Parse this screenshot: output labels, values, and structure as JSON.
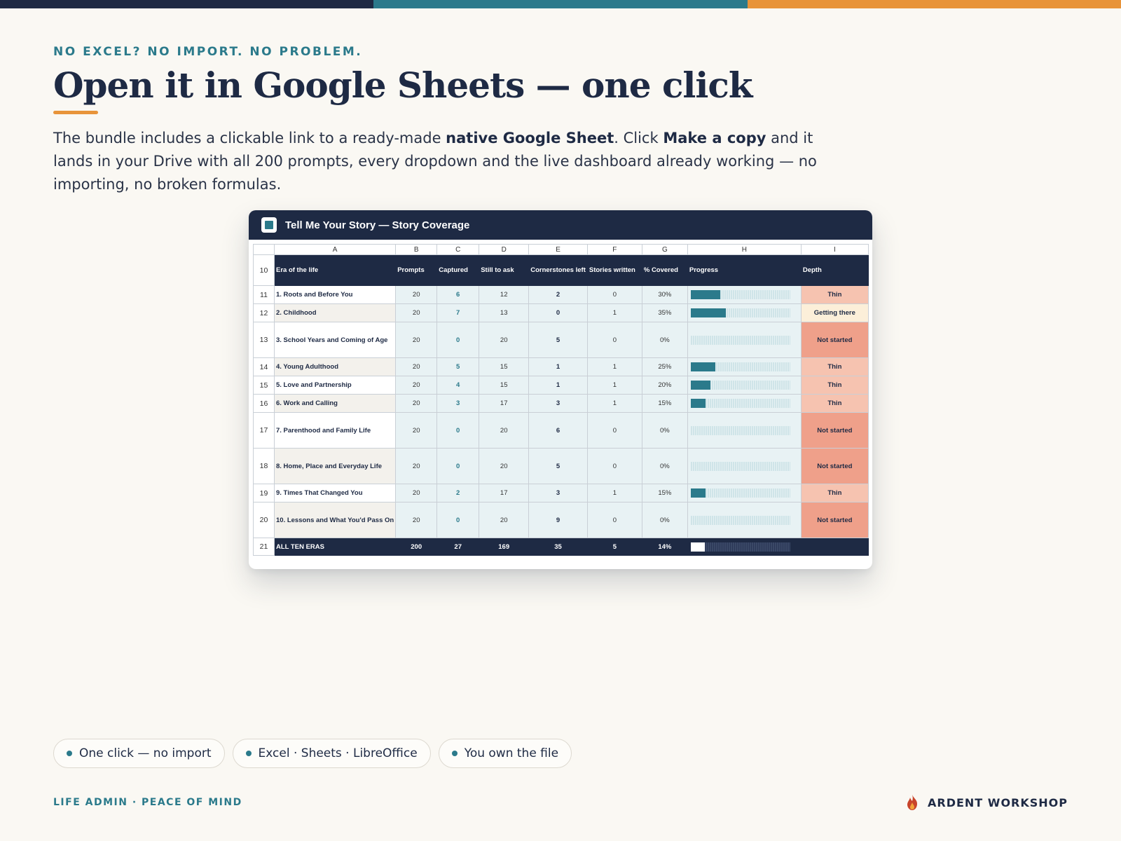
{
  "colors": {
    "navy": "#1E2A44",
    "teal": "#2B7A8B",
    "orange": "#E8943A",
    "background": "#FAF8F3",
    "depth_thin": "#F6C3B0",
    "depth_getting_there": "#FCEFD9",
    "depth_not_started": "#EFA08A"
  },
  "kicker": "NO EXCEL? NO IMPORT. NO PROBLEM.",
  "title": "Open it in Google Sheets — one click",
  "lede": {
    "part1": "The bundle includes a clickable link to a ready-made ",
    "bold1": "native Google Sheet",
    "part2": ". Click ",
    "bold2": "Make a copy",
    "part3": " and it lands in your Drive with all 200 prompts, every dropdown and the live dashboard already working — no importing, no broken formulas."
  },
  "sheet": {
    "icon": "sheets-icon",
    "title": "Tell Me Your Story — Story Coverage",
    "column_letters": [
      "A",
      "B",
      "C",
      "D",
      "E",
      "F",
      "G",
      "H",
      "I"
    ],
    "header_row_num": "10",
    "headers": [
      "Era of the life",
      "Prompts",
      "Captured",
      "Still to ask",
      "Cornerstones left",
      "Stories written",
      "% Covered",
      "Progress",
      "Depth"
    ],
    "rows": [
      {
        "num": "11",
        "era": "1. Roots and Before You",
        "prompts": "20",
        "captured": "6",
        "still": "12",
        "corner": "2",
        "stories": "0",
        "pct": "30%",
        "progress": 0.3,
        "depth": "Thin"
      },
      {
        "num": "12",
        "era": "2. Childhood",
        "prompts": "20",
        "captured": "7",
        "still": "13",
        "corner": "0",
        "stories": "1",
        "pct": "35%",
        "progress": 0.35,
        "depth": "Getting there"
      },
      {
        "num": "13",
        "era": "3. School Years and Coming of Age",
        "prompts": "20",
        "captured": "0",
        "still": "20",
        "corner": "5",
        "stories": "0",
        "pct": "0%",
        "progress": 0,
        "depth": "Not started"
      },
      {
        "num": "14",
        "era": "4. Young Adulthood",
        "prompts": "20",
        "captured": "5",
        "still": "15",
        "corner": "1",
        "stories": "1",
        "pct": "25%",
        "progress": 0.25,
        "depth": "Thin"
      },
      {
        "num": "15",
        "era": "5. Love and Partnership",
        "prompts": "20",
        "captured": "4",
        "still": "15",
        "corner": "1",
        "stories": "1",
        "pct": "20%",
        "progress": 0.2,
        "depth": "Thin"
      },
      {
        "num": "16",
        "era": "6. Work and Calling",
        "prompts": "20",
        "captured": "3",
        "still": "17",
        "corner": "3",
        "stories": "1",
        "pct": "15%",
        "progress": 0.15,
        "depth": "Thin"
      },
      {
        "num": "17",
        "era": "7. Parenthood and Family Life",
        "prompts": "20",
        "captured": "0",
        "still": "20",
        "corner": "6",
        "stories": "0",
        "pct": "0%",
        "progress": 0,
        "depth": "Not started"
      },
      {
        "num": "18",
        "era": "8. Home, Place and Everyday Life",
        "prompts": "20",
        "captured": "0",
        "still": "20",
        "corner": "5",
        "stories": "0",
        "pct": "0%",
        "progress": 0,
        "depth": "Not started"
      },
      {
        "num": "19",
        "era": "9. Times That Changed You",
        "prompts": "20",
        "captured": "2",
        "still": "17",
        "corner": "3",
        "stories": "1",
        "pct": "15%",
        "progress": 0.15,
        "depth": "Thin"
      },
      {
        "num": "20",
        "era": "10. Lessons and What You'd Pass On",
        "prompts": "20",
        "captured": "0",
        "still": "20",
        "corner": "9",
        "stories": "0",
        "pct": "0%",
        "progress": 0,
        "depth": "Not started"
      }
    ],
    "total": {
      "num": "21",
      "era": "ALL TEN ERAS",
      "prompts": "200",
      "captured": "27",
      "still": "169",
      "corner": "35",
      "stories": "5",
      "pct": "14%",
      "progress": 0.14
    }
  },
  "pills": [
    "One click — no import",
    "Excel · Sheets · LibreOffice",
    "You own the file"
  ],
  "footer_left": "LIFE ADMIN · PEACE OF MIND",
  "brand": {
    "icon": "flame-icon",
    "name": "ARDENT WORKSHOP"
  }
}
